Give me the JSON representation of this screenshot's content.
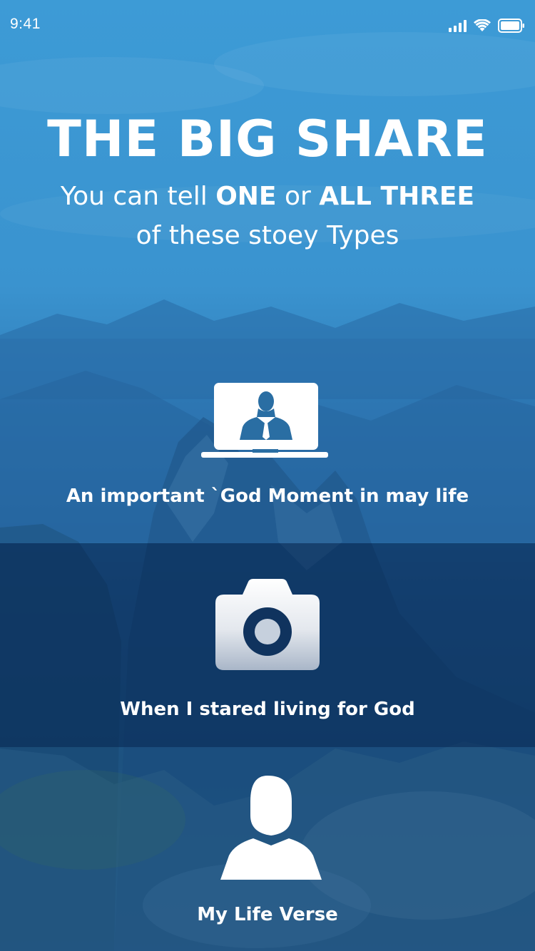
{
  "status_bar": {
    "time": "9:41"
  },
  "header": {
    "title": "THE BIG SHARE",
    "subtitle_part1": "You can tell ",
    "subtitle_bold1": "ONE",
    "subtitle_part2": " or ",
    "subtitle_bold2": "ALL THREE",
    "subtitle_line2": "of these stoey Types"
  },
  "options": [
    {
      "icon": "laptop-user-icon",
      "label": "An important `God Moment in may life"
    },
    {
      "icon": "camera-icon",
      "label": "When I stared living for God"
    },
    {
      "icon": "person-icon",
      "label": "My Life Verse"
    }
  ],
  "colors": {
    "sky_blue": "#3d9bd6",
    "panel_dark": "#0a2f5c",
    "text": "#ffffff"
  }
}
